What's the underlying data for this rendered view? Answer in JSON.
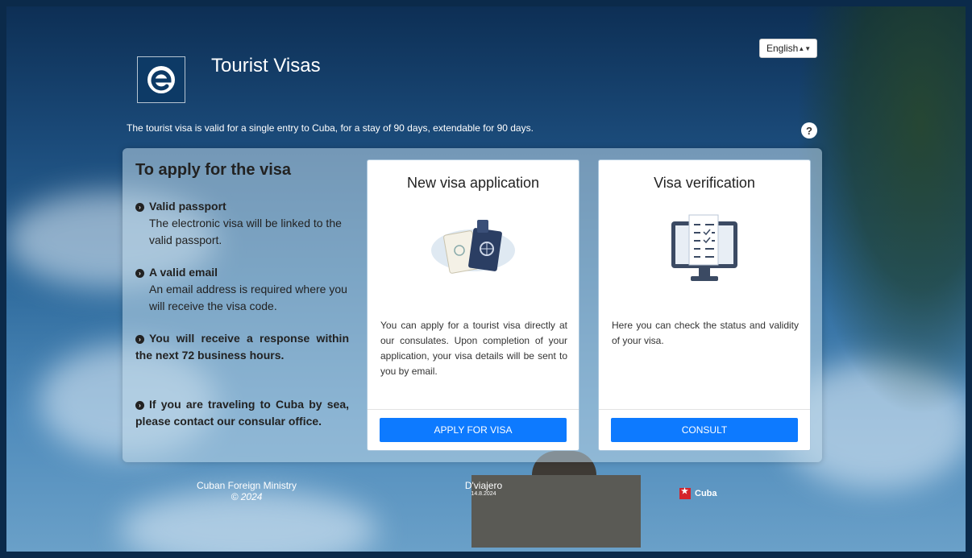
{
  "header": {
    "title": "Tourist Visas",
    "subtitle": "The tourist visa is valid for a single entry to Cuba, for a stay of 90 days, extendable for 90 days.",
    "language": "English",
    "help_glyph": "?"
  },
  "requirements": {
    "title": "To apply for the visa",
    "items": [
      {
        "head": "Valid passport",
        "body": "The electronic visa will be linked to the valid passport."
      },
      {
        "head": "A valid email",
        "body": "An email address is required where you will receive the visa code."
      },
      {
        "head": "You will receive a response within the next 72 business hours."
      },
      {
        "head": "If you are traveling to Cuba by sea, please contact our consular office."
      }
    ]
  },
  "cards": [
    {
      "title": "New visa application",
      "text": "You can apply for a tourist visa directly at our consulates. Upon completion of your application, your visa details will be sent to you by email.",
      "button": "APPLY FOR VISA",
      "icon": "passport-icon"
    },
    {
      "title": "Visa verification",
      "text": "Here you can check the status and validity of your visa.",
      "button": "CONSULT",
      "icon": "monitor-checklist-icon"
    }
  ],
  "footer": {
    "ministry": "Cuban Foreign Ministry",
    "year": "© 2024",
    "app_name": "D'viajero",
    "version": "14.8.2024",
    "country": "Cuba"
  },
  "colors": {
    "button": "#0d7aff",
    "flag": "#d4232b"
  }
}
